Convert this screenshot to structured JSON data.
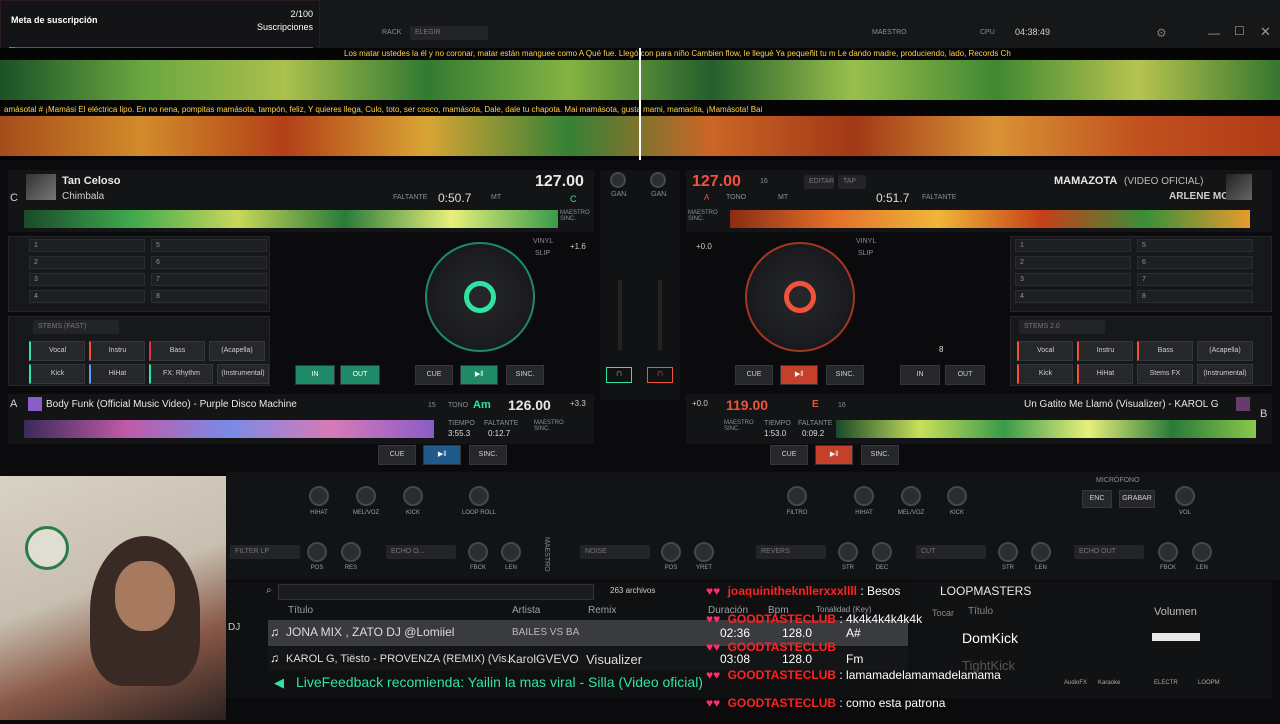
{
  "overlay_goal": {
    "title": "Meta de suscripción",
    "count": "2/100",
    "label": "Suscripciones"
  },
  "topbar": {
    "rack": "RACK",
    "rack_select": "ELEGIR",
    "master": "MAESTRO",
    "cpu": "CPU",
    "time": "04:38:49"
  },
  "lyrics": {
    "top": "Los matar ustedes la él y no coronar, matar están manguee como A   Qué          fue. Llegó con para niño   Cambien flow, le llegué   Ya pequeñit   tu m   Le dando madre, produciendo, lado, Records  Ch",
    "bottom": "amásotal #   ¡Mamási    El eléctrica lipo. En no nena, pompitas mamásota, tampón, feliz, Y quieres llega, Culo, toto, ser cosco, mamásota, Dale, dale tu chapota.                 Mai         mamásota, gusta mami, mamacita, ¡Mamásota!    Bai"
  },
  "deck_c": {
    "letter": "C",
    "title": "Tan Celoso",
    "artist": "Chimbala",
    "remaining_label": "FALTANTE",
    "remaining": "0:50.7",
    "bpm": "127.00",
    "key": "C",
    "mt": "MT",
    "master_sync": "MAESTRO SINC."
  },
  "deck_d": {
    "bpm": "127.00",
    "key_note": "A",
    "title": "MAMAZOTA",
    "title_suffix": "(VIDEO OFICIAL)",
    "artist": "ARLENE MC",
    "remaining": "0:51.7",
    "remaining_label": "FALTANTE",
    "editar": "EDITAR",
    "tap": "TAP",
    "master_sync": "MAESTRO SINC.",
    "tono": "TONO",
    "mt": "MT",
    "sixteen": "16"
  },
  "deck_a": {
    "letter": "A",
    "title": "Body Funk (Official Music Video) - Purple Disco Machine",
    "bpm": "126.00",
    "key": "Am",
    "tono": "TONO",
    "fifteen": "15",
    "time_label": "TIEMPO",
    "time": "3:55.3",
    "remaining_label": "FALTANTE",
    "remaining": "0:12.7",
    "master_sync": "MAESTRO SINC.",
    "pitch": "+3.3"
  },
  "deck_b": {
    "letter": "B",
    "title": "Un Gatito Me Llamó (Visualizer) - KAROL G",
    "bpm": "119.00",
    "key": "E",
    "sixteen": "16",
    "time_label": "TIEMPO",
    "time": "1:53.0",
    "remaining_label": "FALTANTE",
    "remaining": "0:09.2",
    "master_sync": "MAESTRO SINC.",
    "pitch": "+0.0"
  },
  "hotcues_left": [
    "1",
    "2",
    "3",
    "4",
    "5",
    "6",
    "7",
    "8"
  ],
  "hotcues_right": [
    "1",
    "2",
    "3",
    "4",
    "5",
    "6",
    "7",
    "8"
  ],
  "stems_left": {
    "select": "STEMS (FAST)",
    "buttons": [
      "Vocal",
      "Instru",
      "Bass",
      "(Acapella)",
      "Kick",
      "HiHat",
      "FX: Rhythm",
      "(Instrumental)"
    ]
  },
  "stems_right": {
    "select": "STEMS 2.0",
    "buttons": [
      "Vocal",
      "Instru",
      "Bass",
      "(Acapella)",
      "Kick",
      "HiHat",
      "Stems FX",
      "(Instrumental)"
    ]
  },
  "transport": {
    "cue": "CUE",
    "sync": "SINC.",
    "in": "IN",
    "out": "OUT",
    "loop_val": "8",
    "gan": "GAN.",
    "vinyl": "VINYL",
    "slip": "SLIP",
    "pitch_c": "+1.6",
    "pitch_d": "+0.0"
  },
  "fx": {
    "hihat": "HIHAT",
    "melvoz": "MEL/VOZ",
    "kick": "KICK",
    "loop_roll": "LOOP ROLL",
    "filtro": "FILTRO",
    "filter_lp": "FILTER LP",
    "pos": "POS",
    "res": "RES",
    "echo": "ECHO O...",
    "fbck": "FBCK",
    "len": "LEN",
    "noise": "NOISE",
    "yret": "YRET",
    "revers": "REVERS",
    "str": "STR",
    "dec": "DEC",
    "cut": "CUT",
    "echo_out": "ECHO OUT",
    "microfono": "MICRÓFONO",
    "enc": "ENC",
    "grabar": "GRABAR",
    "vol": "VOL",
    "maestro": "MAESTRO"
  },
  "browser": {
    "count": "263 archivos",
    "col_title": "Título",
    "col_artist": "Artista",
    "col_remix": "Remix",
    "col_duration": "Duración",
    "col_bpm": "Bpm",
    "col_key": "Tonalidad (Key)",
    "rows": [
      {
        "title": "JONA MIX , ZATO DJ @Lomiiel",
        "artist": "BAILES VS BA",
        "remix": "",
        "duration": "02:36",
        "bpm": "128.0",
        "key": "A#"
      },
      {
        "title": "KAROL G, Tiësto - PROVENZA (REMIX) (Vis...",
        "artist": "KarolGVEVO",
        "remix": "Visualizer",
        "duration": "03:08",
        "bpm": "128.0",
        "key": "Fm"
      }
    ],
    "feedback": "LiveFeedback recomienda: Yailin la mas viral - Silla (Video oficial)",
    "dj": "DJ"
  },
  "sampler": {
    "title": "LOOPMASTERS",
    "col_play": "Tocar",
    "col_title": "Título",
    "col_vol": "Volumen",
    "item1": "DomKick",
    "item2": "TightKick",
    "tab_karaoke": "Karaoke",
    "tab_electro": "ELECTR",
    "tab_loop": "LOOPM",
    "tab_audiofx": "AudioFX"
  },
  "chat": [
    {
      "user": "joaquinitheknllerxxxllll",
      "message": ": Besos"
    },
    {
      "user": "GOODTASTECLUB",
      "message": ": 4k4k4k4k4k4k"
    },
    {
      "user": "GOODTASTECLUB",
      "message": ""
    },
    {
      "user": "GOODTASTECLUB",
      "message": ": lamamadelamamadelamama"
    },
    {
      "user": "GOODTASTECLUB",
      "message": ": como esta patrona"
    }
  ],
  "colors": {
    "green": "#2fe4a3",
    "red": "#f0533a",
    "accent": "#ffd24a"
  }
}
